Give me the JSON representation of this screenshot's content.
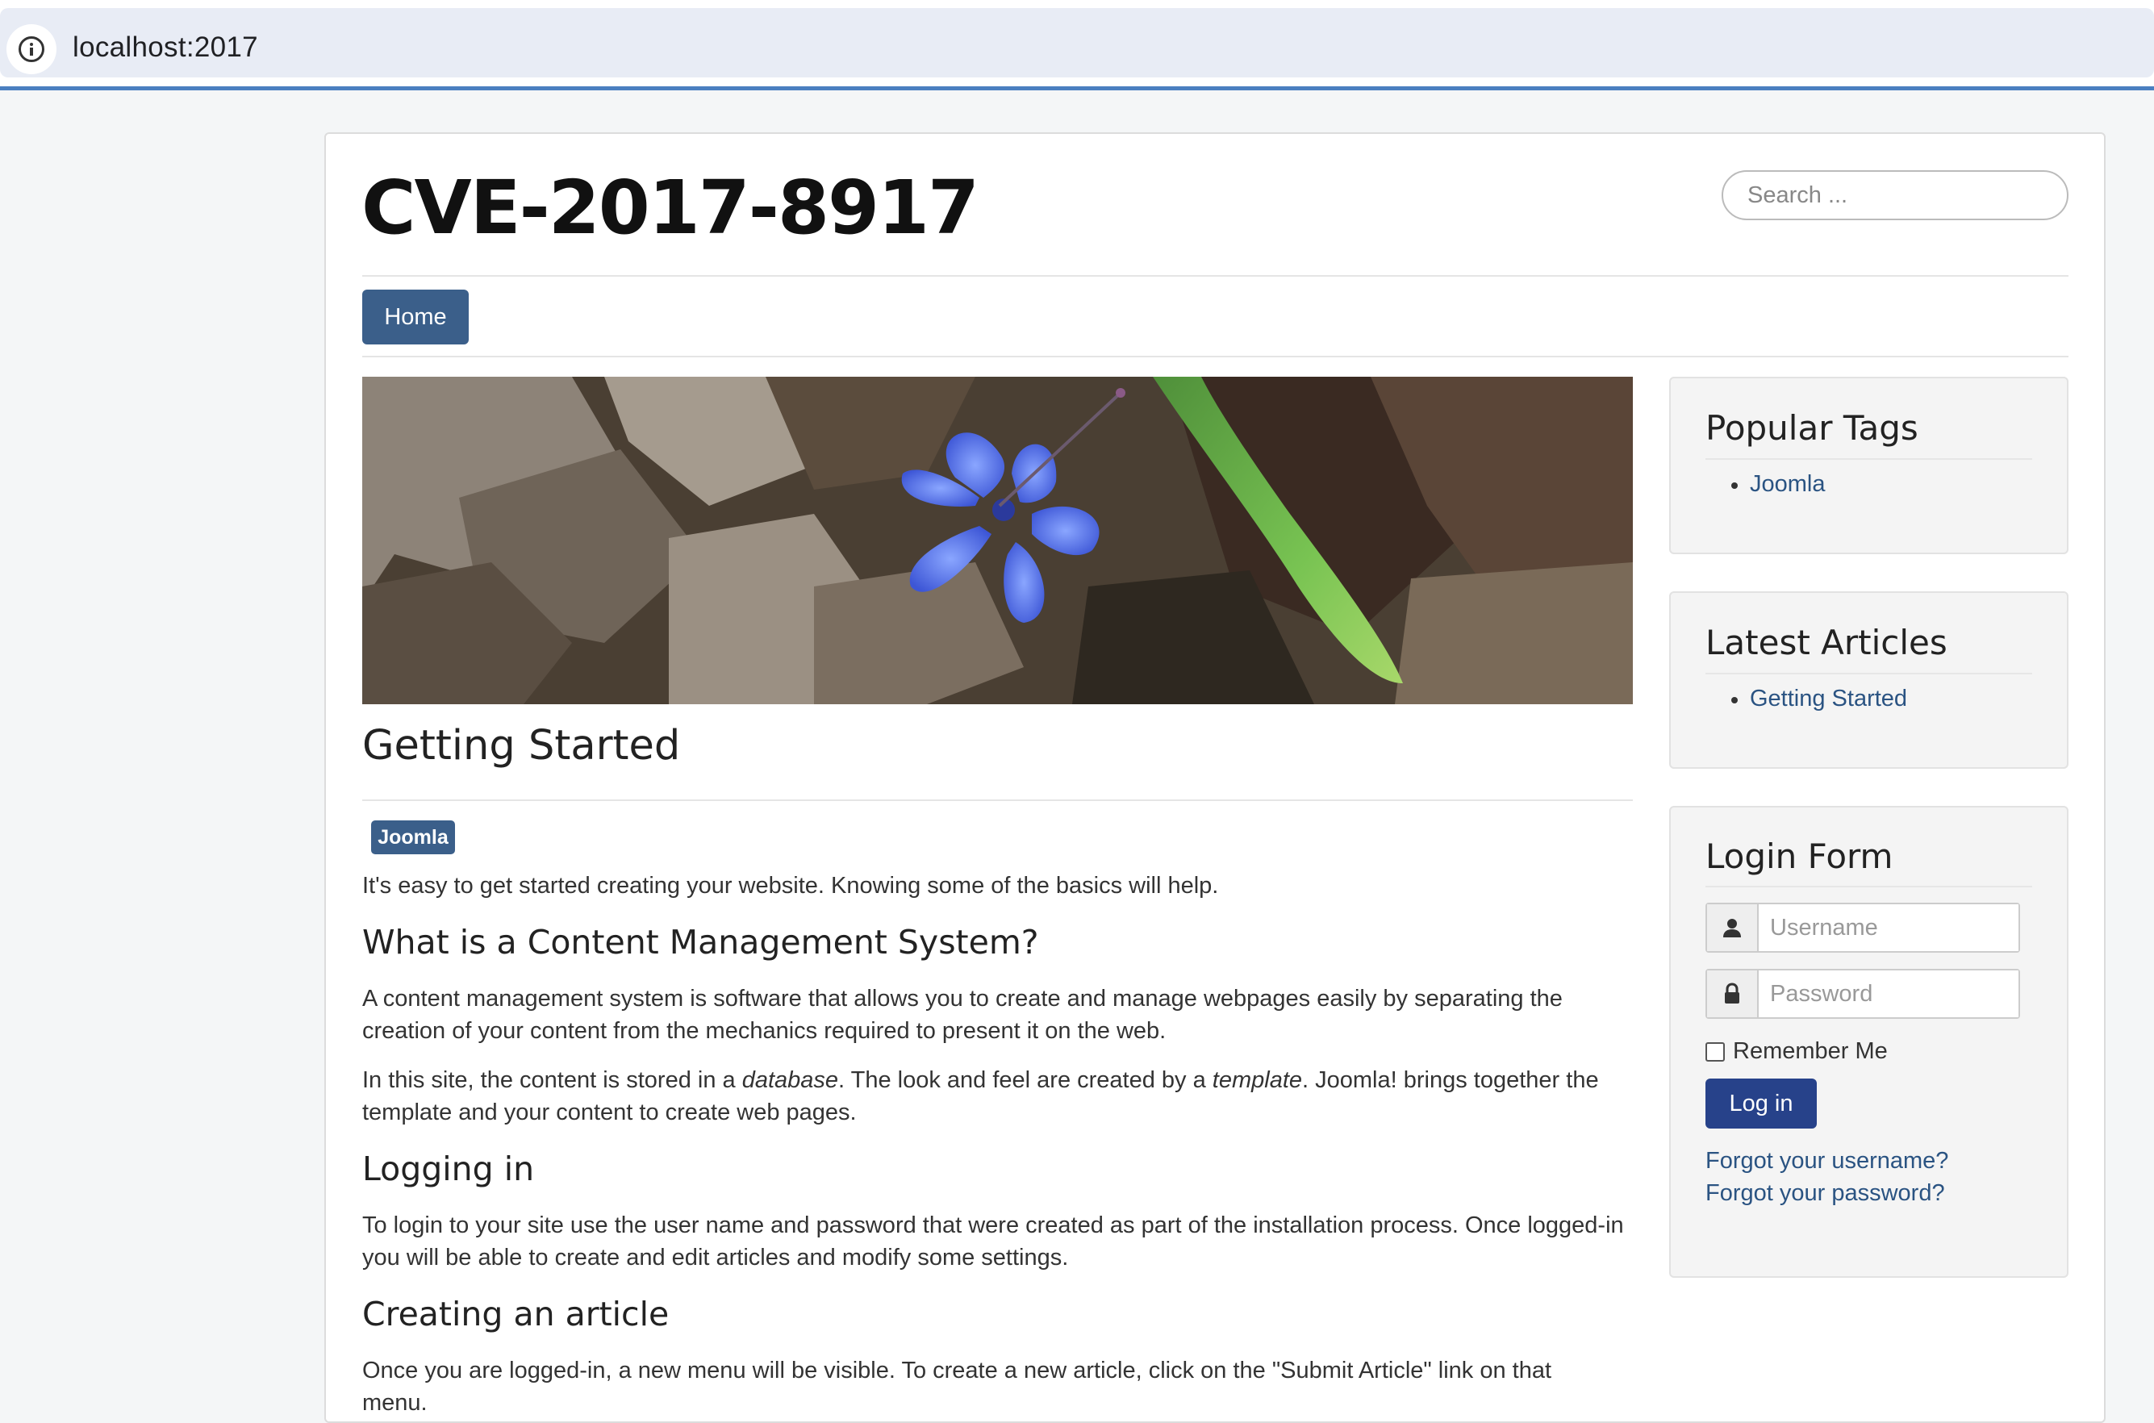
{
  "browser": {
    "url": "localhost:2017"
  },
  "site": {
    "title": "CVE-2017-8917",
    "search_placeholder": "Search ..."
  },
  "nav": {
    "home_label": "Home"
  },
  "article": {
    "title": "Getting Started",
    "tag": "Joomla",
    "intro": "It's easy to get started creating your website. Knowing some of the basics will help.",
    "h_cms": "What is a Content Management System?",
    "p_cms": "A content management system is software that allows you to create and manage webpages easily by separating the creation of your content from the mechanics required to present it on the web.",
    "p_site_1": "In this site, the content is stored in a ",
    "p_site_em1": "database",
    "p_site_2": ". The look and feel are created by a ",
    "p_site_em2": "template",
    "p_site_3": ". Joomla! brings together the template and your content to create web pages.",
    "h_login": "Logging in",
    "p_login": "To login to your site use the user name and password that were created as part of the installation process. Once logged-in you will be able to create and edit articles and modify some settings.",
    "h_create": "Creating an article",
    "p_create": "Once you are logged-in, a new menu will be visible. To create a new article, click on the \"Submit Article\" link on that menu."
  },
  "sidebar": {
    "popular_tags": {
      "title": "Popular Tags",
      "items": [
        "Joomla"
      ]
    },
    "latest_articles": {
      "title": "Latest Articles",
      "items": [
        "Getting Started"
      ]
    },
    "login_form": {
      "title": "Login Form",
      "username_placeholder": "Username",
      "password_placeholder": "Password",
      "remember_label": "Remember Me",
      "login_button": "Log in",
      "forgot_username": "Forgot your username?",
      "forgot_password": "Forgot your password?"
    }
  },
  "colors": {
    "brand": "#3b5f8a",
    "login_button": "#27428a",
    "link": "#2a5382",
    "url_accent": "#4a7fc0"
  },
  "icons": {
    "address_bar": "info-icon",
    "username": "user-icon",
    "password": "lock-icon"
  }
}
